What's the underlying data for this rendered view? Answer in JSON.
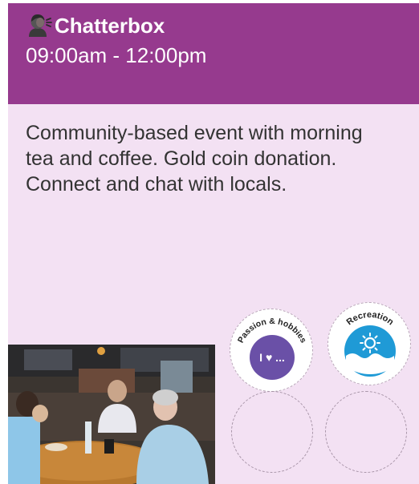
{
  "event": {
    "title": "Chatterbox",
    "time": "09:00am - 12:00pm",
    "description": "Community-based event with morning tea and coffee. Gold coin donation. Connect and chat with locals.",
    "icon": "speaking-head-icon"
  },
  "badges": [
    {
      "label": "Passion & hobbies",
      "icon_text": "I ♥ ...",
      "color": "#6a50a7"
    },
    {
      "label": "Recreation",
      "icon": "sun-over-water-icon",
      "color": "#1f9ad6"
    }
  ],
  "colors": {
    "header": "#963a8e",
    "card_background": "#f3e1f3",
    "text": "#333333"
  }
}
